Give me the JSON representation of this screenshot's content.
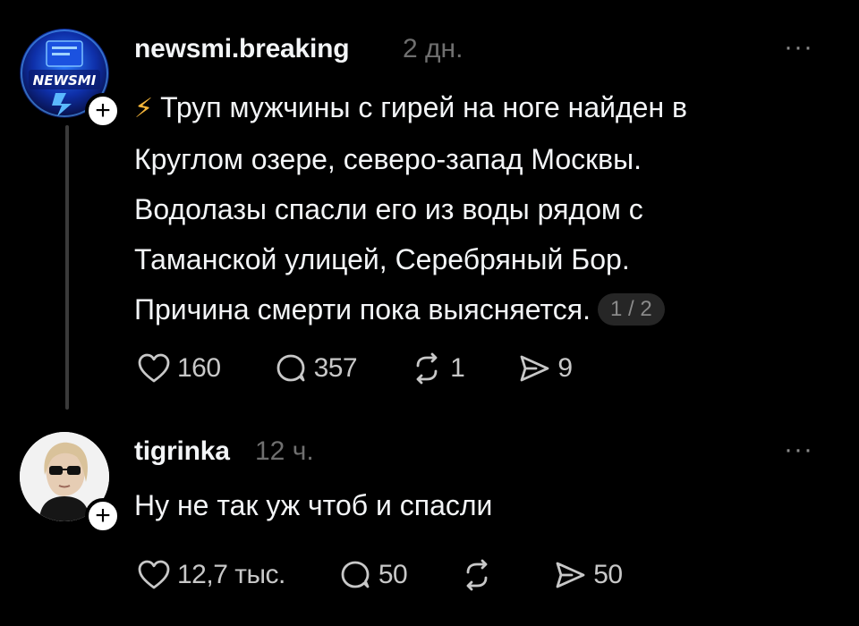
{
  "post": {
    "username": "newsmi.breaking",
    "time": "2 дн.",
    "lines": [
      "Труп мужчины с гирей на ноге найден в",
      "Круглом озере, северо-запад Москвы.",
      "Водолазы спасли его из воды рядом с",
      "Таманской улицей, Серебряный Бор.",
      "Причина смерти пока выясняется."
    ],
    "page_indicator": "1 / 2",
    "likes": "160",
    "comments": "357",
    "reposts": "1",
    "shares": "9",
    "avatar_text": "NEWSMI"
  },
  "reply": {
    "username": "tigrinka",
    "time": "12 ч.",
    "text": "Ну не так уж чтоб и спасли",
    "likes": "12,7 тыс.",
    "comments": "50",
    "reposts": "",
    "shares": "50"
  },
  "more_glyph": "···",
  "follow_glyph": "+",
  "colors": {
    "background": "#000000",
    "text": "#f3f5f7",
    "muted": "#6f6f6f",
    "bolt": "#f5b63a"
  }
}
